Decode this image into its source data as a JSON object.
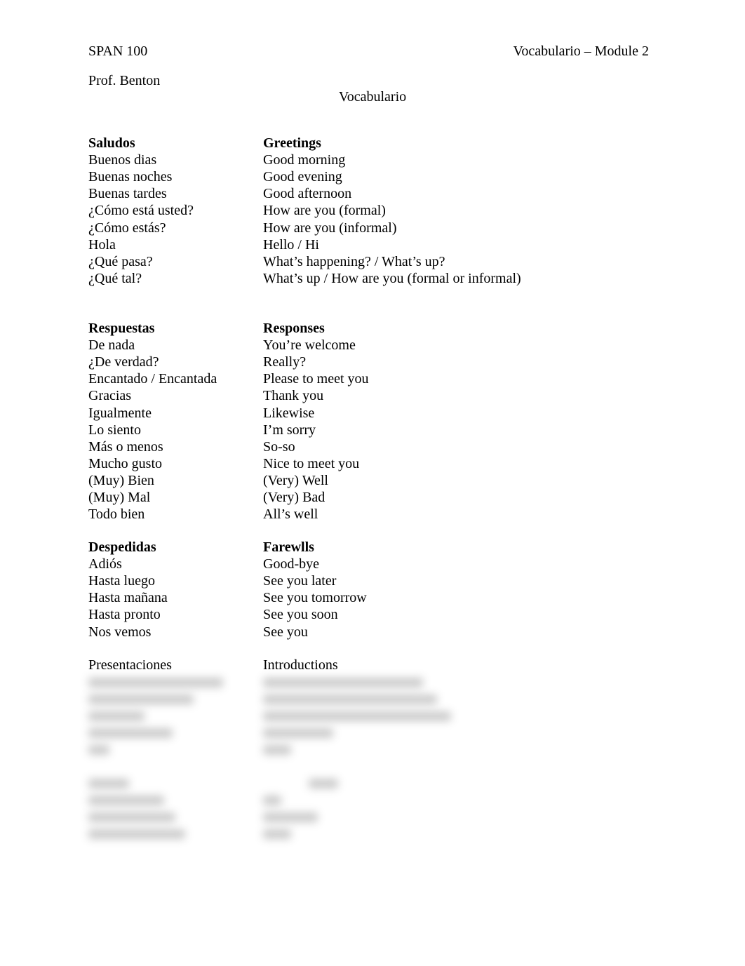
{
  "header": {
    "course": "SPAN 100",
    "module": "Vocabulario – Module 2",
    "professor": "Prof. Benton",
    "title": "Vocabulario"
  },
  "sections": [
    {
      "heading_es": "Saludos",
      "heading_en": "Greetings",
      "bold": true,
      "rows": [
        {
          "es": "Buenos dias",
          "en": "Good morning"
        },
        {
          "es": "Buenas noches",
          "en": "Good evening"
        },
        {
          "es": "Buenas tardes",
          "en": "Good afternoon"
        },
        {
          "es": "¿Cómo está usted?",
          "en": "How are you (formal)"
        },
        {
          "es": "¿Cómo estás?",
          "en": "How are you (informal)"
        },
        {
          "es": "Hola",
          "en": "Hello / Hi"
        },
        {
          "es": "¿Qué pasa?",
          "en": "What’s happening? / What’s up?"
        },
        {
          "es": "¿Qué tal?",
          "en": "What’s up / How are you (formal or informal)"
        }
      ]
    },
    {
      "heading_es": "Respuestas",
      "heading_en": "Responses",
      "bold": true,
      "rows": [
        {
          "es": "De nada",
          "en": "You’re welcome"
        },
        {
          "es": "¿De verdad?",
          "en": "Really?"
        },
        {
          "es": "Encantado / Encantada",
          "en": "Please to meet you"
        },
        {
          "es": "Gracias",
          "en": "Thank you"
        },
        {
          "es": "Igualmente",
          "en": "Likewise"
        },
        {
          "es": "Lo siento",
          "en": "I’m sorry"
        },
        {
          "es": "Más o menos",
          "en": "So-so"
        },
        {
          "es": "Mucho gusto",
          "en": "Nice to meet you"
        },
        {
          "es": "(Muy) Bien",
          "en": "(Very) Well"
        },
        {
          "es": "(Muy) Mal",
          "en": "(Very) Bad"
        },
        {
          "es": "Todo bien",
          "en": "All’s well"
        }
      ]
    },
    {
      "heading_es": "Despedidas",
      "heading_en": "Farewlls",
      "bold": true,
      "rows": [
        {
          "es": "Adiós",
          "en": "Good-bye"
        },
        {
          "es": "Hasta luego",
          "en": "See you later"
        },
        {
          "es": "Hasta mañana",
          "en": "See you tomorrow"
        },
        {
          "es": "Hasta pronto",
          "en": "See you soon"
        },
        {
          "es": "Nos vemos",
          "en": "See you"
        }
      ]
    },
    {
      "heading_es": "Presentaciones",
      "heading_en": "Introductions",
      "bold": false,
      "rows": []
    }
  ]
}
